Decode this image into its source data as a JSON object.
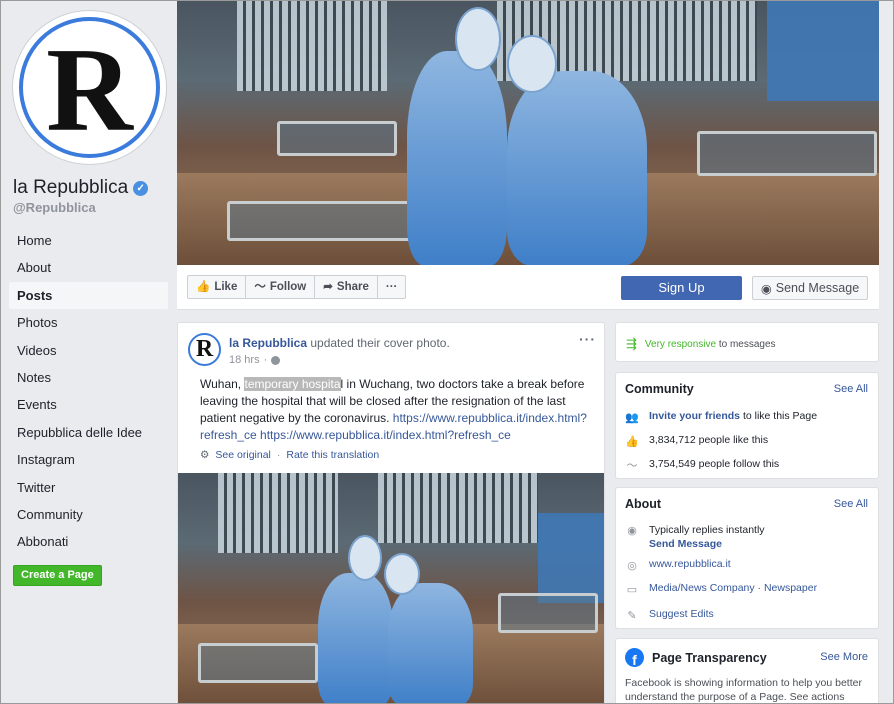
{
  "sidebar": {
    "avatar_letter": "R",
    "page_name": "la Repubblica",
    "handle": "@Repubblica",
    "nav": [
      {
        "label": "Home",
        "active": false
      },
      {
        "label": "About",
        "active": false
      },
      {
        "label": "Posts",
        "active": true
      },
      {
        "label": "Photos",
        "active": false
      },
      {
        "label": "Videos",
        "active": false
      },
      {
        "label": "Notes",
        "active": false
      },
      {
        "label": "Events",
        "active": false
      },
      {
        "label": "Repubblica delle Idee",
        "active": false
      },
      {
        "label": "Instagram",
        "active": false
      },
      {
        "label": "Twitter",
        "active": false
      },
      {
        "label": "Community",
        "active": false
      },
      {
        "label": "Abbonati",
        "active": false
      }
    ],
    "create_page": "Create a Page"
  },
  "actions": {
    "like": "Like",
    "follow": "Follow",
    "share": "Share",
    "more": "···",
    "sign_up": "Sign Up",
    "send_message": "Send Message"
  },
  "post": {
    "avatar_letter": "R",
    "author": "la Repubblica",
    "action": " updated their cover photo.",
    "time": "18 hrs",
    "more": "···",
    "text_before": "Wuhan, ",
    "text_highlight": "temporary hospita",
    "text_after": "l in Wuchang, two doctors take a break before leaving the hospital that will be closed after the resignation of the last patient negative by the coronavirus. ",
    "link1": "https://www.repubblica.it/index.html?refresh_ce",
    "link2": "https://www.repubblica.it/index.html?refresh_ce",
    "see_original": "See original",
    "rate_translation": "Rate this translation"
  },
  "responsive": {
    "highlight": "Very responsive",
    "rest": " to messages"
  },
  "community": {
    "title": "Community",
    "see_all": "See All",
    "invite_link": "Invite your friends",
    "invite_rest": " to like this Page",
    "likes": "3,834,712 people like this",
    "follows": "3,754,549 people follow this"
  },
  "about": {
    "title": "About",
    "see_all": "See All",
    "replies": "Typically replies instantly",
    "send_message": "Send Message",
    "website": "www.repubblica.it",
    "category": "Media/News Company · Newspaper",
    "suggest": "Suggest Edits"
  },
  "transparency": {
    "title": "Page Transparency",
    "see_more": "See More",
    "text": "Facebook is showing information to help you better understand the purpose of a Page. See actions taken by the people who manage and post content."
  },
  "colors": {
    "accent": "#4267b2",
    "link": "#365899",
    "green": "#42b72a",
    "verified": "#4a90e2"
  }
}
